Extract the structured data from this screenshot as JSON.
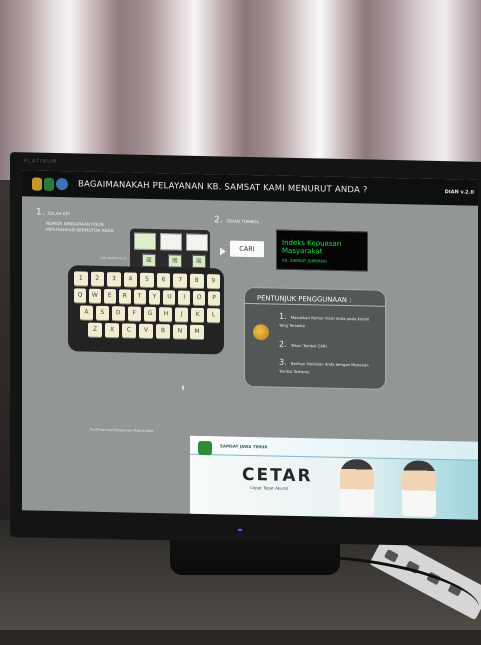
{
  "screen": {
    "header": {
      "title": "BAGAIMANAKAH PELAYANAN KB. SAMSAT KAMI MENURUT ANDA ?",
      "version": "DIAN v.2.0"
    },
    "step1": {
      "number": "1.",
      "lines": [
        "ISILAH KRI",
        "NOMOR KENDARAAN POLISI",
        "PERUSAHAAN BERMOTOR ANDA"
      ]
    },
    "step2": {
      "number": "2.",
      "label": "TEKAN TOMBOL :"
    },
    "plate_color_label": "pilih WARNA PLAT",
    "color_buttons": [
      "☒",
      "☒",
      "☒"
    ],
    "keyboard": {
      "rows": [
        [
          "1",
          "2",
          "3",
          "4",
          "5",
          "6",
          "7",
          "8",
          "9"
        ],
        [
          "Q",
          "W",
          "E",
          "R",
          "T",
          "Y",
          "U",
          "I",
          "O",
          "P"
        ],
        [
          "A",
          "S",
          "D",
          "F",
          "G",
          "H",
          "J",
          "K",
          "L"
        ],
        [
          "Z",
          "X",
          "C",
          "V",
          "B",
          "N",
          "M"
        ]
      ]
    },
    "search_button": "CARI",
    "ikm": {
      "title": "Indeks Kepuasan Masyarakat",
      "subtitle": "KB. SAMSAT JOMBANG"
    },
    "guide": {
      "title": "PENTUNJUK PENGGUNAAN :",
      "items": [
        {
          "num": "1.",
          "text": "Masukkan Nomor Polisi Anda pada Kolom Yang Tersedia"
        },
        {
          "num": "2.",
          "text": "Tekan Tombol CARI"
        },
        {
          "num": "3.",
          "text": "Berikan Penilaian Anda dengan Menekan Tombol Tertentu"
        }
      ]
    },
    "footer_note": "Profil Samsat Pelayanan Masyarakat",
    "banner": {
      "label": "SAMSAT JAWA TIMUR",
      "brand": "CETAR",
      "tagline": "Cepat Tepat Akurat"
    }
  },
  "bezel_label": "PLATINUM"
}
